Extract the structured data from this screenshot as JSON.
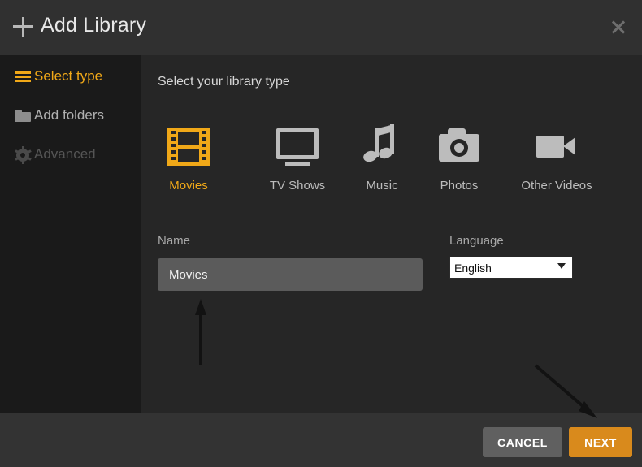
{
  "header": {
    "title": "Add Library",
    "plus_icon": "plus-icon",
    "close_icon": "close-icon"
  },
  "sidebar": {
    "items": [
      {
        "label": "Select type",
        "icon": "list-icon",
        "state": "active"
      },
      {
        "label": "Add folders",
        "icon": "folder-icon",
        "state": "enabled"
      },
      {
        "label": "Advanced",
        "icon": "gear-icon",
        "state": "disabled"
      }
    ]
  },
  "main": {
    "section_title": "Select your library type",
    "library_types": [
      {
        "label": "Movies",
        "icon": "film-strip-icon",
        "selected": true
      },
      {
        "label": "TV Shows",
        "icon": "television-icon",
        "selected": false
      },
      {
        "label": "Music",
        "icon": "music-note-icon",
        "selected": false
      },
      {
        "label": "Photos",
        "icon": "camera-icon",
        "selected": false
      },
      {
        "label": "Other Videos",
        "icon": "video-camera-icon",
        "selected": false
      }
    ],
    "name_field": {
      "label": "Name",
      "value": "Movies",
      "placeholder": "Name"
    },
    "language_field": {
      "label": "Language",
      "value": "English",
      "options": [
        "English"
      ],
      "arrow_icon": "chevron-down-icon"
    }
  },
  "footer": {
    "cancel_label": "CANCEL",
    "next_label": "NEXT"
  },
  "annotations": [
    {
      "name": "arrow-to-name-field",
      "direction": "up"
    },
    {
      "name": "arrow-to-next-button",
      "direction": "down-right"
    }
  ],
  "colors": {
    "accent": "#f0a818",
    "next_button": "#d98a1c",
    "cancel_button": "#606060",
    "header_bg": "#303030",
    "sidebar_bg": "#1a1a1a",
    "content_bg": "#262626",
    "footer_bg": "#333333",
    "input_bg": "#5b5b5b"
  }
}
